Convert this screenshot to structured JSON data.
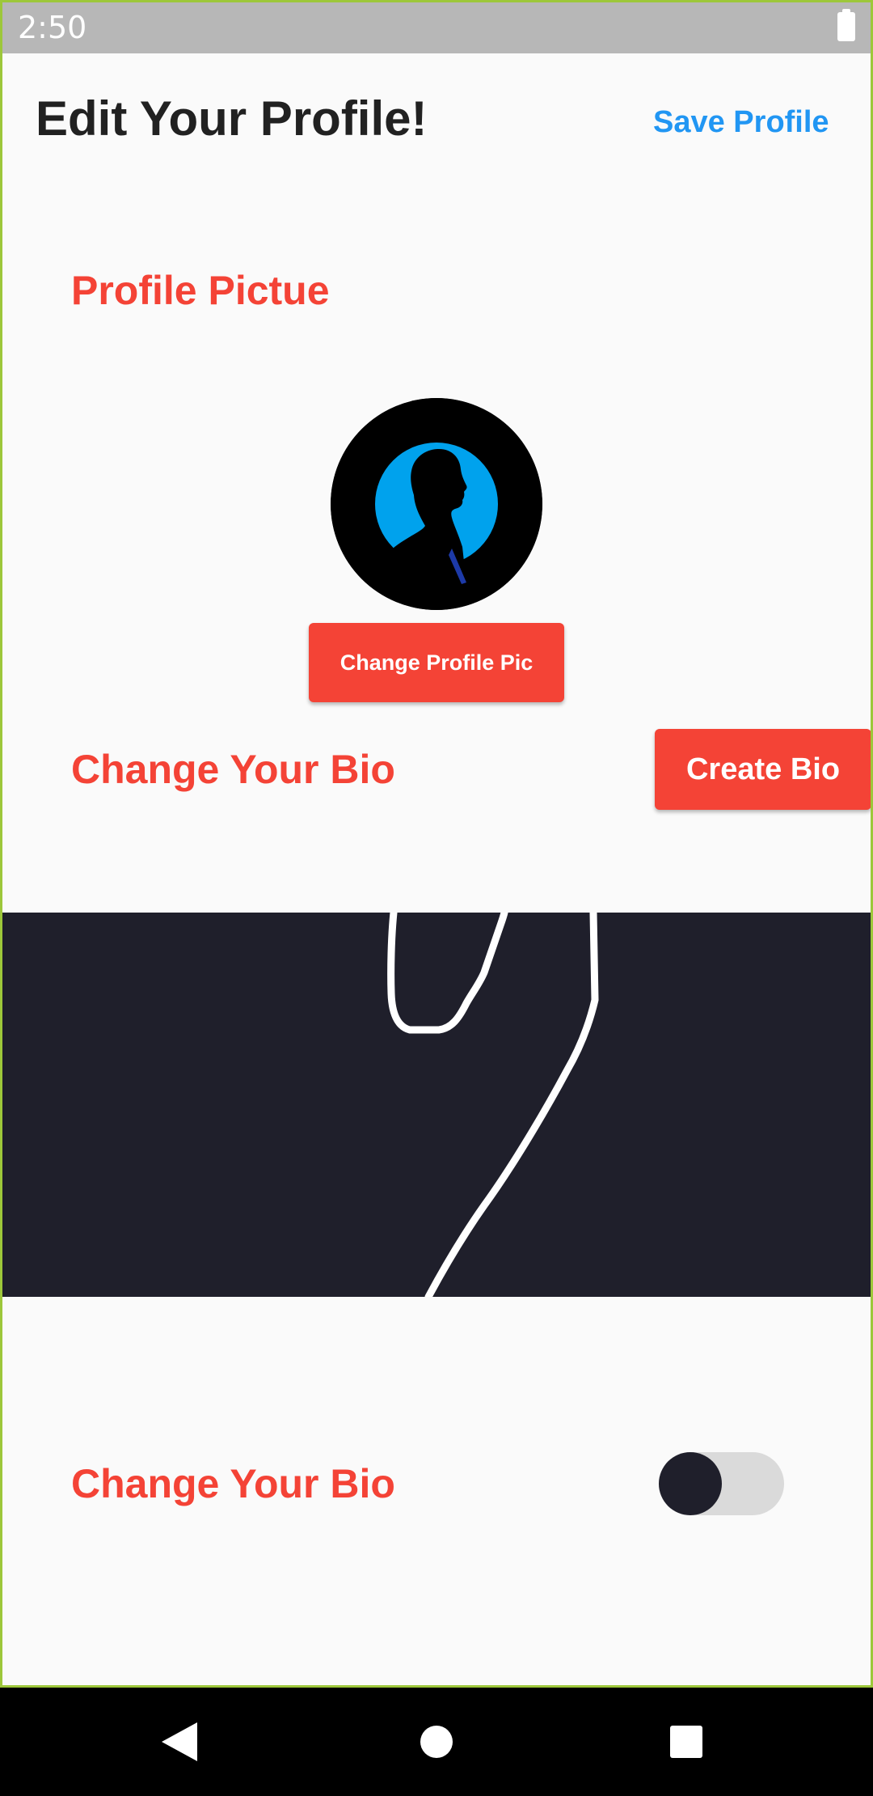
{
  "status_bar": {
    "time": "2:50"
  },
  "header": {
    "title": "Edit Your Profile!",
    "save_label": "Save Profile"
  },
  "profile_picture": {
    "label": "Profile Pictue",
    "change_button": "Change Profile Pic"
  },
  "bio": {
    "label": "Change Your Bio",
    "create_button": "Create Bio"
  },
  "bio_toggle": {
    "label": "Change Your Bio",
    "state": "off"
  },
  "nav_bar": {
    "icons": [
      "back-icon",
      "home-icon",
      "recents-icon"
    ]
  },
  "colors": {
    "accent_red": "#f44336",
    "link_blue": "#2196f3",
    "dark_canvas": "#1f1f2b",
    "status_bar": "#b7b7b7"
  }
}
